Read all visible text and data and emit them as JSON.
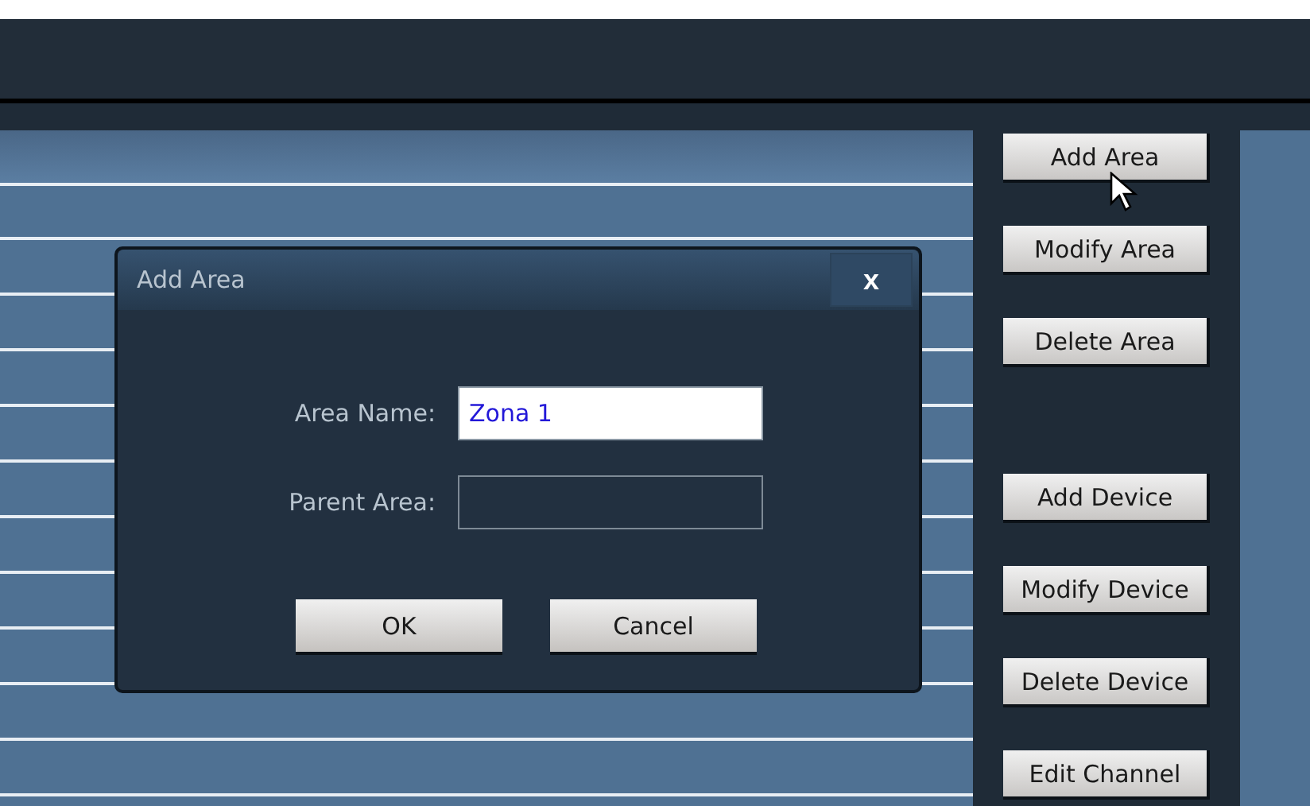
{
  "area_buttons": [
    "Add Area",
    "Modify Area",
    "Delete Area"
  ],
  "device_buttons": [
    "Add Device",
    "Modify Device",
    "Delete Device",
    "Edit Channel"
  ],
  "dialog": {
    "title": "Add Area",
    "close": "x",
    "fields": [
      {
        "label": "Area Name:",
        "value": "Zona 1",
        "disabled": false
      },
      {
        "label": "Parent Area:",
        "disabled": true
      }
    ],
    "buttons": [
      "OK",
      "Cancel"
    ]
  }
}
